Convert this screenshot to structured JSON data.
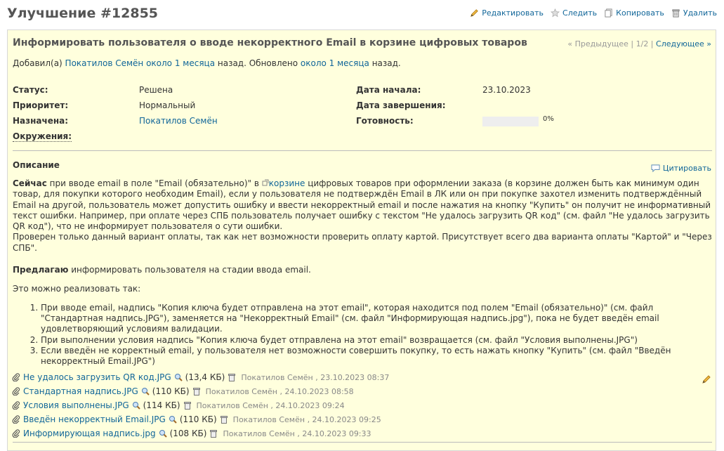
{
  "issue": {
    "title": "Улучшение #12855",
    "subject": "Информировать пользователя о вводе некорректного Email в корзине цифровых товаров"
  },
  "actions": {
    "edit": "Редактировать",
    "watch": "Следить",
    "copy": "Копировать",
    "delete": "Удалить"
  },
  "nav": {
    "prev": "« Предыдущее",
    "sep1": " | ",
    "position": "1/2",
    "sep2": " | ",
    "next": "Следующее »"
  },
  "author_line": {
    "prefix": "Добавил(а) ",
    "author": "Покатилов Семён",
    "space": " ",
    "added_ago": "около 1 месяца",
    "middle": " назад. Обновлено ",
    "updated_ago": "около 1 месяца",
    "suffix": " назад."
  },
  "attributes": {
    "status_label": "Статус:",
    "status_value": "Решена",
    "priority_label": "Приоритет:",
    "priority_value": "Нормальный",
    "assigned_label": "Назначена:",
    "assigned_value": "Покатилов Семён",
    "env_label": "Окружения:",
    "start_label": "Дата начала:",
    "start_value": "23.10.2023",
    "due_label": "Дата завершения:",
    "done_label": "Готовность:",
    "done_value": "0%",
    "done_ratio": 0
  },
  "description": {
    "heading": "Описание",
    "quote": "Цитировать",
    "p1_bold": "Сейчас",
    "p1_a": " при вводе email в поле \"Email (обязательно)\" в ",
    "p1_link": "корзине",
    "p1_b": " цифровых товаров при оформлении заказа (в корзине должен быть как минимум один товар, для покупки которого необходим Email), если у пользователя не подтверждён Email в ЛК или он при покупке захотел изменить подтверждённый Email на другой, пользователь может допустить ошибку и ввести некорректный email и после нажатия на кнопку \"Купить\" он получит не информативный текст ошибки. Например, при оплате через СПБ пользователь получает ошибку с текстом \"Не удалось загрузить QR код\" (см. файл \"Не удалось загрузить QR код\"), что не информирует пользователя о сути ошибки.",
    "p1_c": "Проверен только данный вариант оплаты, так как нет возможности проверить оплату картой. Присутствует всего два варианта оплаты \"Картой\" и \"Через СПБ\".",
    "p2_bold": "Предлагаю",
    "p2_text": " информировать пользователя на стадии ввода email.",
    "p3": "Это можно реализовать так:",
    "items": [
      "При вводе email, надпись \"Копия ключа будет отправлена на этот email\", которая находится под полем \"Email (обязательно)\" (см. файл \"Стандартная надпись.JPG\"), заменяется на \"Некорректный Email\" (см. файл \"Информирующая надпись.jpg\"), пока не будет введён email удовлетворяющий условиям валидации.",
      "При выполнении условия надпись \"Копия ключа будет отправлена на этот email\" возвращается (см. файл \"Условия выполнены.JPG\")",
      "Если введён не корректный email, у пользователя нет возможности совершить покупку, то есть нажать кнопку \"Купить\" (см. файл \"Введён некорректный Email.JPG\")"
    ]
  },
  "attachments": [
    {
      "name": "Не удалось загрузить QR код.JPG",
      "size": "(13,4 КБ)",
      "author": "Покатилов Семён",
      "date": ", 23.10.2023 08:37"
    },
    {
      "name": "Стандартная надпись.JPG",
      "size": "(110 КБ)",
      "author": "Покатилов Семён",
      "date": ", 24.10.2023 08:58"
    },
    {
      "name": "Условия выполнены.JPG",
      "size": "(114 КБ)",
      "author": "Покатилов Семён",
      "date": ", 24.10.2023 09:24"
    },
    {
      "name": "Введён некорректный Email.JPG",
      "size": "(110 КБ)",
      "author": "Покатилов Семён",
      "date": ", 24.10.2023 09:25"
    },
    {
      "name": "Информирующая надпись.jpg",
      "size": "(108 КБ)",
      "author": "Покатилов Семён",
      "date": ", 24.10.2023 09:33"
    }
  ]
}
